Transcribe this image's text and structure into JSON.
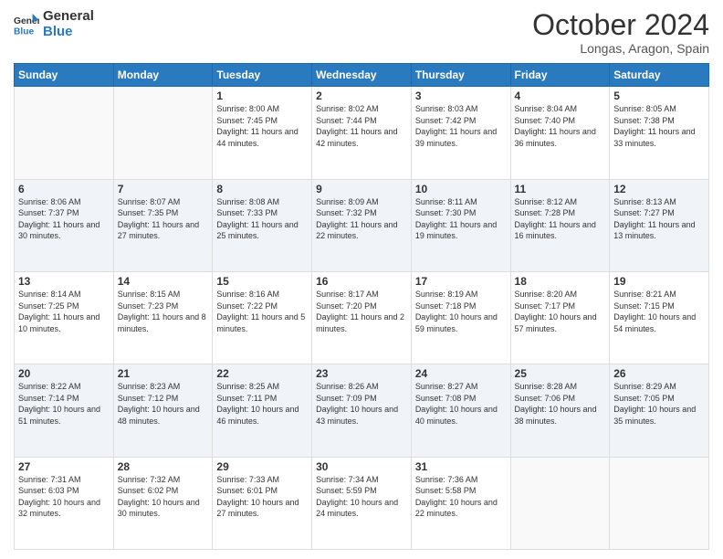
{
  "header": {
    "logo_general": "General",
    "logo_blue": "Blue",
    "title": "October 2024",
    "location": "Longas, Aragon, Spain"
  },
  "calendar": {
    "days_of_week": [
      "Sunday",
      "Monday",
      "Tuesday",
      "Wednesday",
      "Thursday",
      "Friday",
      "Saturday"
    ],
    "weeks": [
      [
        {
          "day": "",
          "sunrise": "",
          "sunset": "",
          "daylight": ""
        },
        {
          "day": "",
          "sunrise": "",
          "sunset": "",
          "daylight": ""
        },
        {
          "day": "1",
          "sunrise": "Sunrise: 8:00 AM",
          "sunset": "Sunset: 7:45 PM",
          "daylight": "Daylight: 11 hours and 44 minutes."
        },
        {
          "day": "2",
          "sunrise": "Sunrise: 8:02 AM",
          "sunset": "Sunset: 7:44 PM",
          "daylight": "Daylight: 11 hours and 42 minutes."
        },
        {
          "day": "3",
          "sunrise": "Sunrise: 8:03 AM",
          "sunset": "Sunset: 7:42 PM",
          "daylight": "Daylight: 11 hours and 39 minutes."
        },
        {
          "day": "4",
          "sunrise": "Sunrise: 8:04 AM",
          "sunset": "Sunset: 7:40 PM",
          "daylight": "Daylight: 11 hours and 36 minutes."
        },
        {
          "day": "5",
          "sunrise": "Sunrise: 8:05 AM",
          "sunset": "Sunset: 7:38 PM",
          "daylight": "Daylight: 11 hours and 33 minutes."
        }
      ],
      [
        {
          "day": "6",
          "sunrise": "Sunrise: 8:06 AM",
          "sunset": "Sunset: 7:37 PM",
          "daylight": "Daylight: 11 hours and 30 minutes."
        },
        {
          "day": "7",
          "sunrise": "Sunrise: 8:07 AM",
          "sunset": "Sunset: 7:35 PM",
          "daylight": "Daylight: 11 hours and 27 minutes."
        },
        {
          "day": "8",
          "sunrise": "Sunrise: 8:08 AM",
          "sunset": "Sunset: 7:33 PM",
          "daylight": "Daylight: 11 hours and 25 minutes."
        },
        {
          "day": "9",
          "sunrise": "Sunrise: 8:09 AM",
          "sunset": "Sunset: 7:32 PM",
          "daylight": "Daylight: 11 hours and 22 minutes."
        },
        {
          "day": "10",
          "sunrise": "Sunrise: 8:11 AM",
          "sunset": "Sunset: 7:30 PM",
          "daylight": "Daylight: 11 hours and 19 minutes."
        },
        {
          "day": "11",
          "sunrise": "Sunrise: 8:12 AM",
          "sunset": "Sunset: 7:28 PM",
          "daylight": "Daylight: 11 hours and 16 minutes."
        },
        {
          "day": "12",
          "sunrise": "Sunrise: 8:13 AM",
          "sunset": "Sunset: 7:27 PM",
          "daylight": "Daylight: 11 hours and 13 minutes."
        }
      ],
      [
        {
          "day": "13",
          "sunrise": "Sunrise: 8:14 AM",
          "sunset": "Sunset: 7:25 PM",
          "daylight": "Daylight: 11 hours and 10 minutes."
        },
        {
          "day": "14",
          "sunrise": "Sunrise: 8:15 AM",
          "sunset": "Sunset: 7:23 PM",
          "daylight": "Daylight: 11 hours and 8 minutes."
        },
        {
          "day": "15",
          "sunrise": "Sunrise: 8:16 AM",
          "sunset": "Sunset: 7:22 PM",
          "daylight": "Daylight: 11 hours and 5 minutes."
        },
        {
          "day": "16",
          "sunrise": "Sunrise: 8:17 AM",
          "sunset": "Sunset: 7:20 PM",
          "daylight": "Daylight: 11 hours and 2 minutes."
        },
        {
          "day": "17",
          "sunrise": "Sunrise: 8:19 AM",
          "sunset": "Sunset: 7:18 PM",
          "daylight": "Daylight: 10 hours and 59 minutes."
        },
        {
          "day": "18",
          "sunrise": "Sunrise: 8:20 AM",
          "sunset": "Sunset: 7:17 PM",
          "daylight": "Daylight: 10 hours and 57 minutes."
        },
        {
          "day": "19",
          "sunrise": "Sunrise: 8:21 AM",
          "sunset": "Sunset: 7:15 PM",
          "daylight": "Daylight: 10 hours and 54 minutes."
        }
      ],
      [
        {
          "day": "20",
          "sunrise": "Sunrise: 8:22 AM",
          "sunset": "Sunset: 7:14 PM",
          "daylight": "Daylight: 10 hours and 51 minutes."
        },
        {
          "day": "21",
          "sunrise": "Sunrise: 8:23 AM",
          "sunset": "Sunset: 7:12 PM",
          "daylight": "Daylight: 10 hours and 48 minutes."
        },
        {
          "day": "22",
          "sunrise": "Sunrise: 8:25 AM",
          "sunset": "Sunset: 7:11 PM",
          "daylight": "Daylight: 10 hours and 46 minutes."
        },
        {
          "day": "23",
          "sunrise": "Sunrise: 8:26 AM",
          "sunset": "Sunset: 7:09 PM",
          "daylight": "Daylight: 10 hours and 43 minutes."
        },
        {
          "day": "24",
          "sunrise": "Sunrise: 8:27 AM",
          "sunset": "Sunset: 7:08 PM",
          "daylight": "Daylight: 10 hours and 40 minutes."
        },
        {
          "day": "25",
          "sunrise": "Sunrise: 8:28 AM",
          "sunset": "Sunset: 7:06 PM",
          "daylight": "Daylight: 10 hours and 38 minutes."
        },
        {
          "day": "26",
          "sunrise": "Sunrise: 8:29 AM",
          "sunset": "Sunset: 7:05 PM",
          "daylight": "Daylight: 10 hours and 35 minutes."
        }
      ],
      [
        {
          "day": "27",
          "sunrise": "Sunrise: 7:31 AM",
          "sunset": "Sunset: 6:03 PM",
          "daylight": "Daylight: 10 hours and 32 minutes."
        },
        {
          "day": "28",
          "sunrise": "Sunrise: 7:32 AM",
          "sunset": "Sunset: 6:02 PM",
          "daylight": "Daylight: 10 hours and 30 minutes."
        },
        {
          "day": "29",
          "sunrise": "Sunrise: 7:33 AM",
          "sunset": "Sunset: 6:01 PM",
          "daylight": "Daylight: 10 hours and 27 minutes."
        },
        {
          "day": "30",
          "sunrise": "Sunrise: 7:34 AM",
          "sunset": "Sunset: 5:59 PM",
          "daylight": "Daylight: 10 hours and 24 minutes."
        },
        {
          "day": "31",
          "sunrise": "Sunrise: 7:36 AM",
          "sunset": "Sunset: 5:58 PM",
          "daylight": "Daylight: 10 hours and 22 minutes."
        },
        {
          "day": "",
          "sunrise": "",
          "sunset": "",
          "daylight": ""
        },
        {
          "day": "",
          "sunrise": "",
          "sunset": "",
          "daylight": ""
        }
      ]
    ]
  }
}
